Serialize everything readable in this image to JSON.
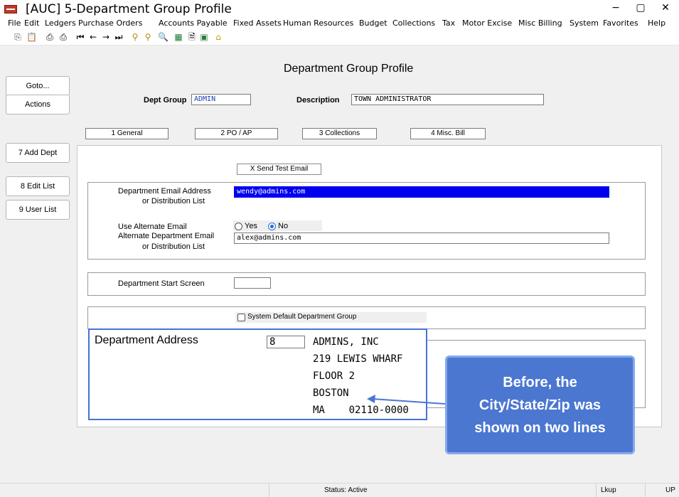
{
  "window": {
    "title": "[AUC] 5-Department Group Profile",
    "minimize": "−",
    "maximize": "▢",
    "close": "✕"
  },
  "menu": [
    "File",
    "Edit",
    "Ledgers",
    "Purchase Orders",
    "Accounts Payable",
    "Fixed Assets",
    "Human Resources",
    "Budget",
    "Collections",
    "Tax",
    "Motor Excise",
    "Misc Billing",
    "System",
    "Favorites",
    "Help"
  ],
  "toolbar": [
    "copy-icon",
    "paste-icon",
    "print-icon",
    "print-preview-icon",
    "first-record-icon",
    "prev-record-icon",
    "next-record-icon",
    "last-record-icon",
    "binoculars-icon",
    "binoculars-alt-icon",
    "search-icon",
    "spreadsheet-icon",
    "document-icon",
    "image-icon",
    "home-icon"
  ],
  "left_buttons": {
    "goto": "Goto...",
    "actions": "Actions",
    "add_dept": "7 Add Dept",
    "edit_list": "8 Edit List",
    "user_list": "9 User List"
  },
  "page_title": "Department Group Profile",
  "header": {
    "dept_group_label": "Dept Group",
    "dept_group_value": "ADMIN",
    "description_label": "Description",
    "description_value": "TOWN ADMINISTRATOR"
  },
  "tabs": [
    "1 General",
    "2 PO / AP",
    "3 Collections",
    "4 Misc. Bill"
  ],
  "general": {
    "send_test_email": "X Send Test Email",
    "email_label_1": "Department Email Address",
    "email_label_2": "or Distribution List",
    "email_value": "wendy@admins.com",
    "use_alt_label": "Use Alternate Email",
    "yes": "Yes",
    "no": "No",
    "alt_label_1": "Alternate Department Email",
    "alt_label_2": "or Distribution List",
    "alt_value": "alex@admins.com",
    "start_screen_label": "Department Start Screen",
    "start_screen_value": "",
    "system_default_label": "System Default Department Group"
  },
  "address": {
    "label": "Department Address",
    "code": "8",
    "lines": [
      "ADMINS, INC",
      "219 LEWIS WHARF",
      "FLOOR 2",
      "BOSTON",
      "MA    02110-0000"
    ]
  },
  "callout": [
    "Before, the",
    "City/State/Zip was",
    "shown on two lines"
  ],
  "status": {
    "text": "Status: Active",
    "lkup": "Lkup",
    "mode": "UP"
  }
}
